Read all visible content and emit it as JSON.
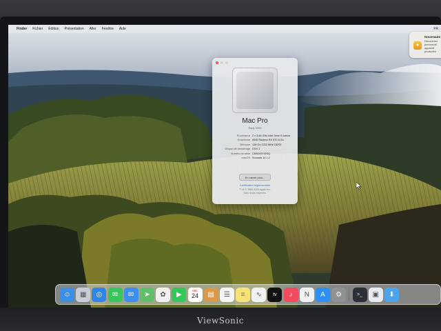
{
  "brand": "ViewSonic",
  "menubar": {
    "apple": "",
    "items": [
      "Finder",
      "Fichier",
      "Édition",
      "Présentation",
      "Aller",
      "Fenêtre",
      "Aide"
    ],
    "right": "FR"
  },
  "notification": {
    "title": "Nouveaute",
    "lines": [
      "Découvrez",
      "personnal",
      "appareil",
      "productivi"
    ]
  },
  "about": {
    "title": "Mac Pro",
    "subtitle": "Early 2009",
    "specs": [
      {
        "k": "Processeur",
        "v": "2 x 3,46 GHz Intel Xeon 6 cœurs"
      },
      {
        "k": "Graphisme",
        "v": "AMD Radeon RX 570 8 Go"
      },
      {
        "k": "Mémoire",
        "v": "128 Go 1333 MHz DDR3"
      },
      {
        "k": "Disque de démarrage",
        "v": "OSX 1"
      },
      {
        "k": "Numéro de série",
        "v": "CK94X0Y920Q"
      },
      {
        "k": "macOS",
        "v": "Sonoma 14.1.2"
      }
    ],
    "more_button": "En savoir plus...",
    "certificate": "Certification réglementaire",
    "copyright": [
      "™ et © 1983-2024 Apple Inc.",
      "Tous droits réservés."
    ]
  },
  "dock": {
    "calendar_month": "DÉC",
    "calendar_day": "24",
    "tv_label": "tv",
    "apps": [
      {
        "icon": "finder-icon",
        "color": "#3b8fe6"
      },
      {
        "icon": "launchpad-icon",
        "color": "#c9ced6"
      },
      {
        "icon": "safari-icon",
        "color": "#2f86e8"
      },
      {
        "icon": "messages-icon",
        "color": "#35c759"
      },
      {
        "icon": "mail-icon",
        "color": "#3c8ff0"
      },
      {
        "icon": "maps-icon",
        "color": "#5fbf6b"
      },
      {
        "icon": "photos-icon",
        "color": "#f1f1f1"
      },
      {
        "icon": "facetime-icon",
        "color": "#34c759"
      },
      {
        "icon": "calendar-icon",
        "color": "#ffffff"
      },
      {
        "icon": "notes-brown-icon",
        "color": "#d89a4a"
      },
      {
        "icon": "reminders-icon",
        "color": "#f5f5f5"
      },
      {
        "icon": "notes-icon",
        "color": "#f7e27a"
      },
      {
        "icon": "freeform-icon",
        "color": "#f0f2f5"
      },
      {
        "icon": "apple-tv-icon",
        "color": "#111111"
      },
      {
        "icon": "music-icon",
        "color": "#f34a5e"
      },
      {
        "icon": "news-icon",
        "color": "#f2f2f2"
      },
      {
        "icon": "app-store-icon",
        "color": "#2d8ff3"
      },
      {
        "icon": "system-settings-icon",
        "color": "#8e9196"
      },
      {
        "icon": "terminal-icon",
        "color": "#2b2f36"
      },
      {
        "icon": "preview-icon",
        "color": "#e8ecf2"
      },
      {
        "icon": "downloads-folder-icon",
        "color": "#4da3ec"
      }
    ]
  }
}
